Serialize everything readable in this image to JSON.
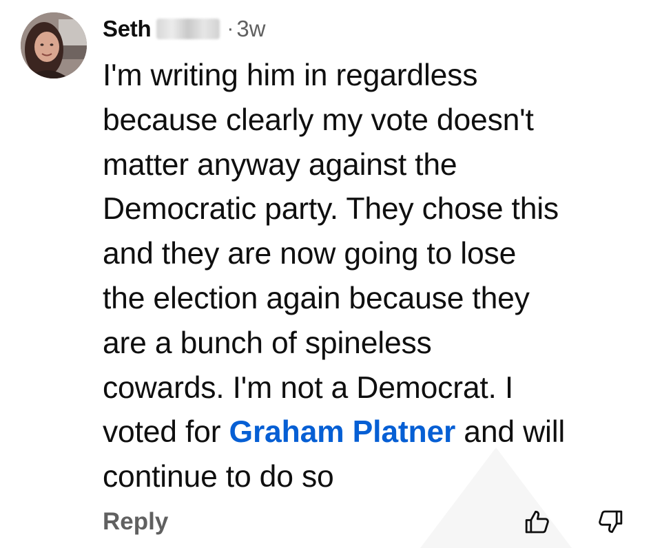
{
  "comment": {
    "author": "Seth",
    "separator": "·",
    "time_ago": "3w",
    "body_lines": [
      "I'm writing him in regardless",
      "because clearly my vote doesn't",
      "matter anyway against the",
      "Democratic party. They chose this",
      "and they are now going to lose",
      "the election again because they",
      "are a bunch of spineless",
      "cowards. I'm not a Democrat. I"
    ],
    "line9_before": "voted for ",
    "mention": "Graham Platner",
    "line9_after": " and will",
    "line10": "continue to do so"
  },
  "actions": {
    "reply_label": "Reply",
    "like_icon": "thumbs-up-icon",
    "dislike_icon": "thumbs-down-icon"
  },
  "colors": {
    "text": "#0f0f0f",
    "secondary": "#606060",
    "mention": "#065fd4"
  }
}
